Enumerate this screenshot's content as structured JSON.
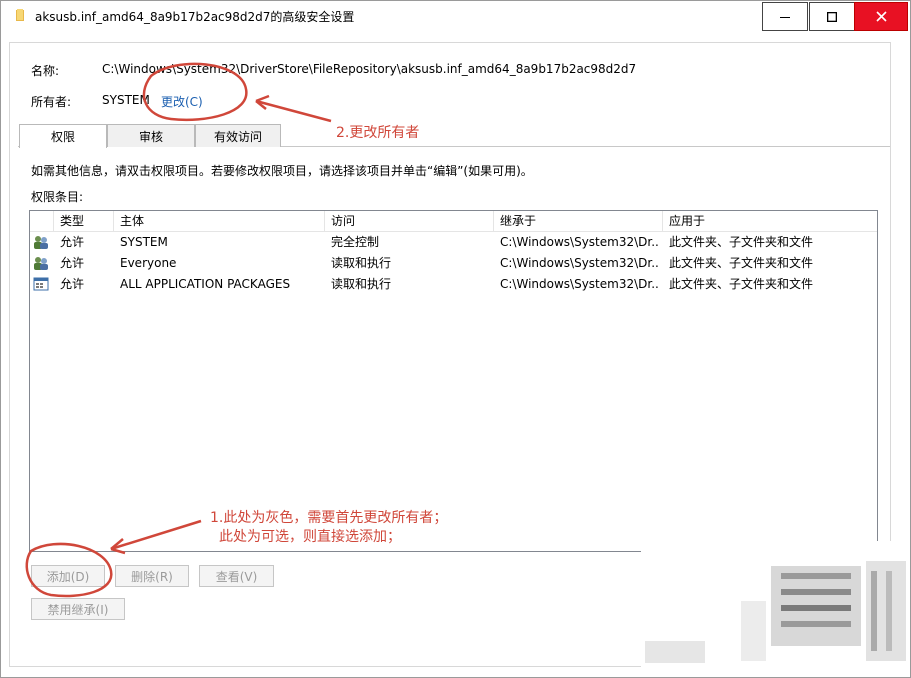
{
  "window": {
    "title": "aksusb.inf_amd64_8a9b17b2ac98d2d7的高级安全设置"
  },
  "fields": {
    "name_label": "名称:",
    "name_value": "C:\\Windows\\System32\\DriverStore\\FileRepository\\aksusb.inf_amd64_8a9b17b2ac98d2d7",
    "owner_label": "所有者:",
    "owner_value": "SYSTEM",
    "change_link": "更改(C)"
  },
  "tabs": [
    {
      "label": "权限",
      "active": true
    },
    {
      "label": "审核",
      "active": false
    },
    {
      "label": "有效访问",
      "active": false
    }
  ],
  "info_text": "如需其他信息，请双击权限项目。若要修改权限项目，请选择该项目并单击“编辑”(如果可用)。",
  "entries_label": "权限条目:",
  "table": {
    "columns": [
      "类型",
      "主体",
      "访问",
      "继承于",
      "应用于"
    ],
    "rows": [
      {
        "icon": "users-icon",
        "type": "允许",
        "principal": "SYSTEM",
        "access": "完全控制",
        "inherited": "C:\\Windows\\System32\\Dr...",
        "applies": "此文件夹、子文件夹和文件"
      },
      {
        "icon": "users-icon",
        "type": "允许",
        "principal": "Everyone",
        "access": "读取和执行",
        "inherited": "C:\\Windows\\System32\\Dr...",
        "applies": "此文件夹、子文件夹和文件"
      },
      {
        "icon": "app-packages-icon",
        "type": "允许",
        "principal": "ALL APPLICATION PACKAGES",
        "access": "读取和执行",
        "inherited": "C:\\Windows\\System32\\Dr...",
        "applies": "此文件夹、子文件夹和文件"
      }
    ]
  },
  "buttons": {
    "add": "添加(D)",
    "remove": "删除(R)",
    "view": "查看(V)",
    "disable_inheritance": "禁用继承(I)"
  },
  "annotations": {
    "step2": "2.更改所有者",
    "step1_line1": "1.此处为灰色，需要首先更改所有者；",
    "step1_line2": "此处为可选，则直接选添加；"
  },
  "colors": {
    "annotation": "#d0473a",
    "link": "#1b5fb0",
    "close_button": "#e81123",
    "disabled_text": "#9b9b9b"
  }
}
